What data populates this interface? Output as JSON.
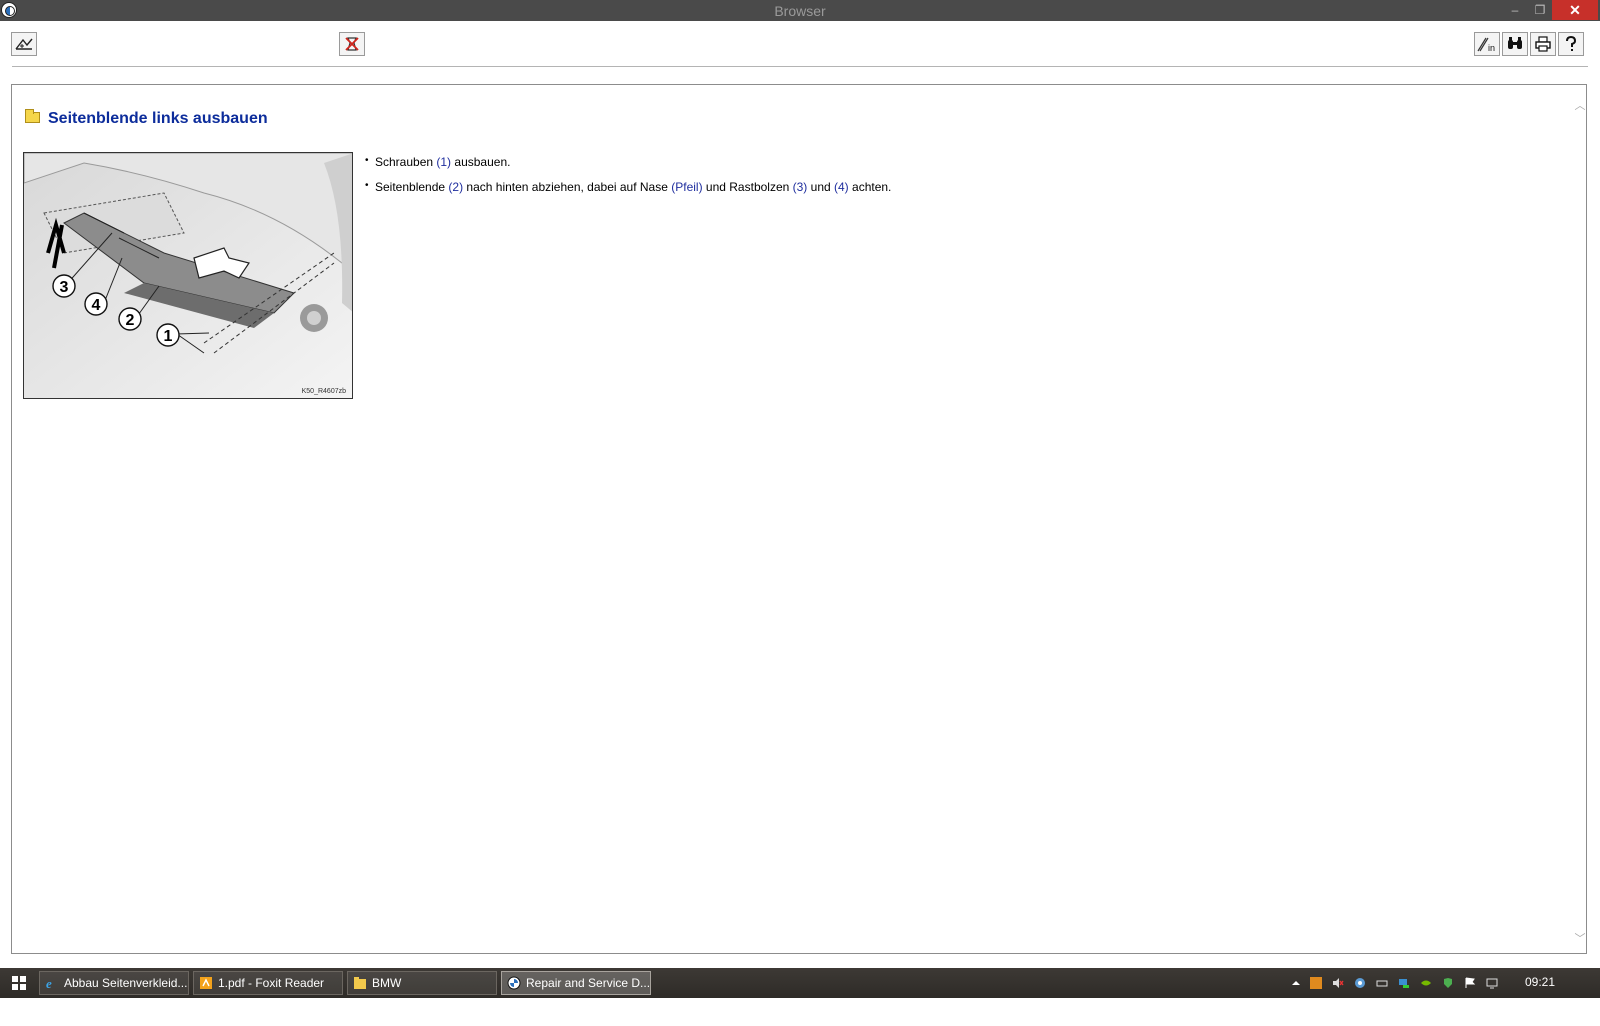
{
  "window": {
    "title": "Browser",
    "minimize_glyph": "–",
    "restore_glyph": "❐",
    "close_glyph": "✕"
  },
  "toolbar": {
    "left_buttons": [
      {
        "name": "back-icon"
      },
      {
        "name": "no-repair-icon"
      }
    ],
    "right_buttons": [
      {
        "name": "info-icon"
      },
      {
        "name": "binoculars-icon"
      },
      {
        "name": "print-icon"
      },
      {
        "name": "help-icon"
      }
    ]
  },
  "document": {
    "heading": "Seitenblende links ausbauen",
    "figure": {
      "code": "K50_R4607zb",
      "callouts": [
        "1",
        "2",
        "3",
        "4"
      ]
    },
    "steps": [
      {
        "parts": [
          {
            "text": "Schrauben ",
            "ref": false
          },
          {
            "text": "(1)",
            "ref": true
          },
          {
            "text": " ausbauen.",
            "ref": false
          }
        ]
      },
      {
        "parts": [
          {
            "text": "Seitenblende ",
            "ref": false
          },
          {
            "text": "(2)",
            "ref": true
          },
          {
            "text": " nach hinten abziehen, dabei auf Nase ",
            "ref": false
          },
          {
            "text": "(Pfeil)",
            "ref": true
          },
          {
            "text": " und Rastbolzen ",
            "ref": false
          },
          {
            "text": "(3)",
            "ref": true
          },
          {
            "text": " und ",
            "ref": false
          },
          {
            "text": "(4)",
            "ref": true
          },
          {
            "text": " achten.",
            "ref": false
          }
        ]
      }
    ]
  },
  "taskbar": {
    "items": [
      {
        "label": "Abbau Seitenverkleid...",
        "icon": "ie-icon",
        "active": false
      },
      {
        "label": "1.pdf - Foxit Reader",
        "icon": "pdf-icon",
        "active": false
      },
      {
        "label": "BMW",
        "icon": "folder-icon",
        "active": false
      },
      {
        "label": "Repair and Service D...",
        "icon": "bmw-icon",
        "active": true
      }
    ],
    "clock": "09:21",
    "tray_icons": [
      "show-hidden-icon",
      "app-tray-icon",
      "speaker-muted-icon",
      "network-icon",
      "battery-icon",
      "network-status-icon",
      "nvidia-icon",
      "security-icon",
      "flag-icon",
      "display-icon"
    ]
  },
  "colors": {
    "heading": "#0c2c9b",
    "reference": "#1f2e9e",
    "close_button": "#c7302a",
    "titlebar": "#4a4a4a"
  }
}
